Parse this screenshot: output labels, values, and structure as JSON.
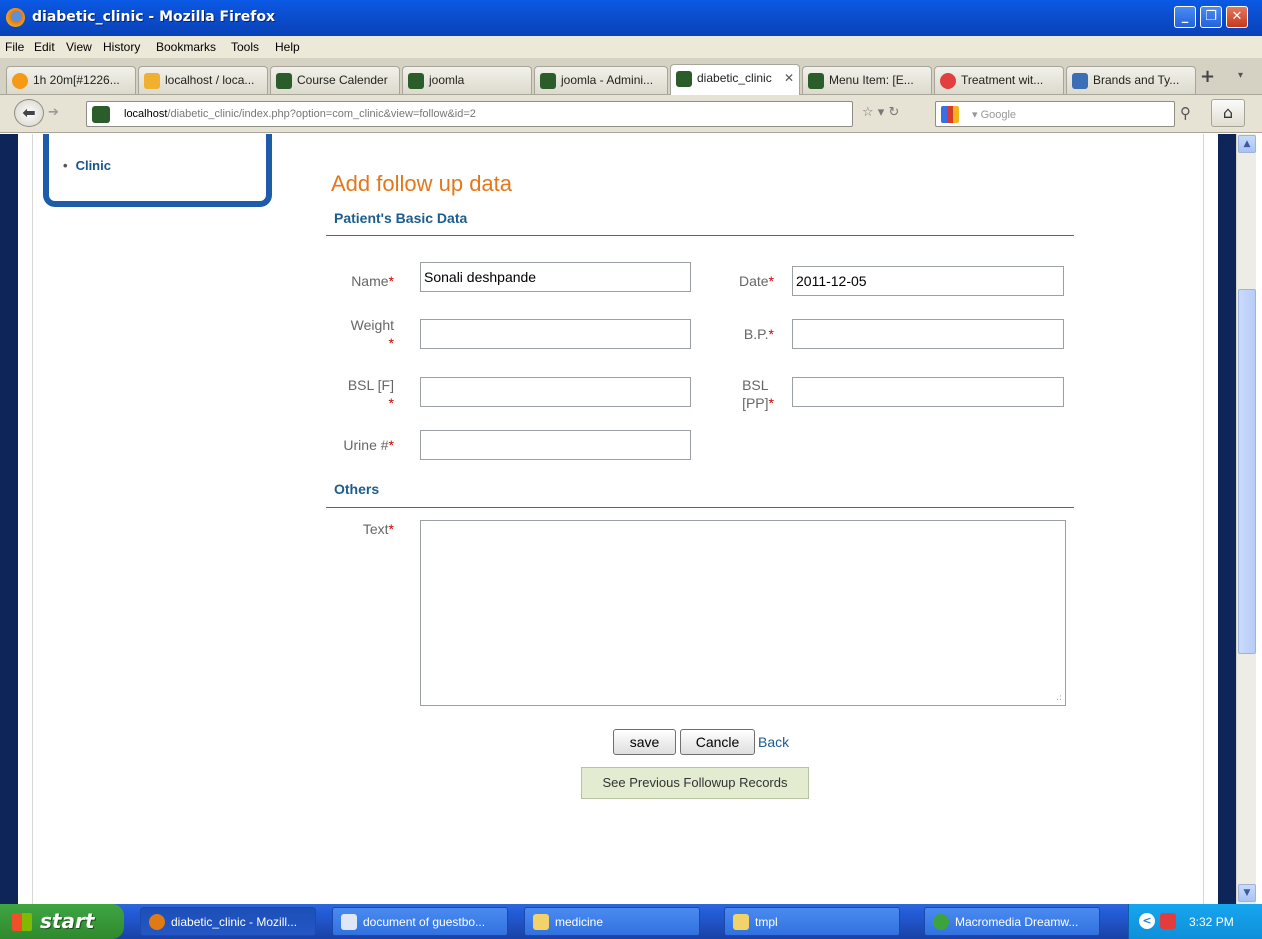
{
  "window": {
    "title": "diabetic_clinic - Mozilla Firefox"
  },
  "menu": [
    "File",
    "Edit",
    "View",
    "History",
    "Bookmarks",
    "Tools",
    "Help"
  ],
  "tabs": [
    {
      "label": "1h 20m[#1226...",
      "icon": "clock-icon"
    },
    {
      "label": "localhost / loca...",
      "icon": "phpmyadmin-icon"
    },
    {
      "label": "Course Calender",
      "icon": "joomla-icon"
    },
    {
      "label": "joomla",
      "icon": "joomla-icon"
    },
    {
      "label": "joomla - Admini...",
      "icon": "joomla-icon"
    },
    {
      "label": "diabetic_clinic",
      "icon": "joomla-icon",
      "active": true
    },
    {
      "label": "Menu Item: [E...",
      "icon": "joomla-icon"
    },
    {
      "label": "Treatment wit...",
      "icon": "heart-icon"
    },
    {
      "label": "Brands and Ty...",
      "icon": "webmd-icon"
    }
  ],
  "nav": {
    "url_host": "localhost",
    "url_path": "/diabetic_clinic/index.php?option=com_clinic&view=follow&id=2",
    "search_placeholder": "Google"
  },
  "sidebar": {
    "items": [
      "Clinic"
    ]
  },
  "page": {
    "title": "Add follow up data",
    "section_basic": "Patient's Basic Data",
    "section_others": "Others",
    "fields": {
      "name": {
        "label": "Name",
        "value": "Sonali deshpande"
      },
      "date": {
        "label": "Date",
        "value": "2011-12-05"
      },
      "weight": {
        "label": "Weight",
        "value": ""
      },
      "bp": {
        "label": "B.P.",
        "value": ""
      },
      "bsl_f": {
        "label": "BSL [F]",
        "value": ""
      },
      "bsl_pp": {
        "label": "BSL [PP]",
        "value": ""
      },
      "urine": {
        "label": "Urine #",
        "value": ""
      },
      "text": {
        "label": "Text",
        "value": ""
      }
    },
    "required_mark": "*",
    "buttons": {
      "save": "save",
      "cancel": "Cancle",
      "back": "Back",
      "previous": "See Previous Followup Records"
    }
  },
  "taskbar": {
    "start": "start",
    "tasks": [
      "diabetic_clinic - Mozill...",
      "document of guestbo...",
      "medicine",
      "tmpl",
      "Macromedia Dreamw..."
    ],
    "clock": "3:32 PM"
  }
}
